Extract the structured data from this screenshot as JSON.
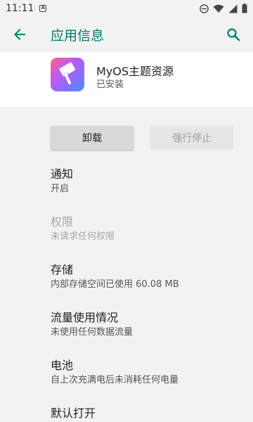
{
  "status_bar": {
    "time": "11:11",
    "left_icon_glyph": "A"
  },
  "app_bar": {
    "title": "应用信息"
  },
  "app": {
    "name": "MyOS主题资源",
    "status": "已安装"
  },
  "buttons": {
    "uninstall": "卸载",
    "force_stop": "强行停止"
  },
  "settings": [
    {
      "title": "通知",
      "summary": "开启",
      "enabled": true
    },
    {
      "title": "权限",
      "summary": "未请求任何权限",
      "enabled": false
    },
    {
      "title": "存储",
      "summary": "内部存储空间已使用 60.08 MB",
      "enabled": true
    },
    {
      "title": "流量使用情况",
      "summary": "未使用任何数据流量",
      "enabled": true
    },
    {
      "title": "电池",
      "summary": "自上次充满电后未消耗任何电量",
      "enabled": true
    },
    {
      "title": "默认打开",
      "summary": "",
      "enabled": true
    }
  ],
  "colors": {
    "accent": "#00796b",
    "background": "#f2f2f2"
  }
}
